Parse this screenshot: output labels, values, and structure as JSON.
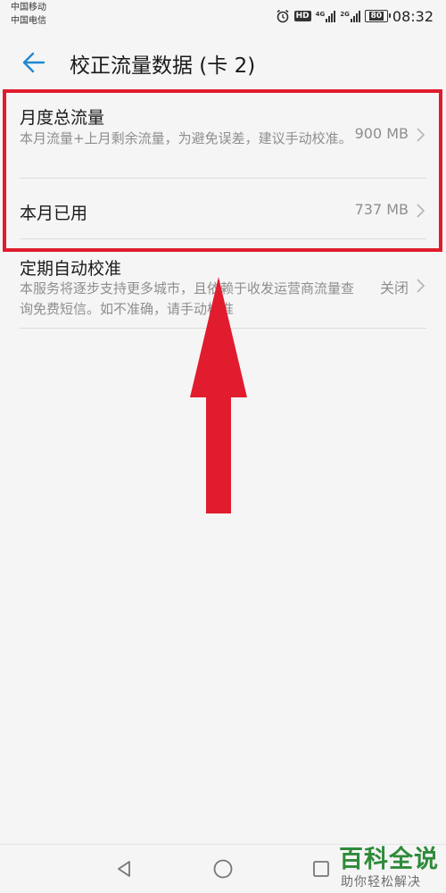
{
  "status_bar": {
    "carrier_1": "中国移动",
    "carrier_2": "中国电信",
    "alarm_icon": "alarm-clock-icon",
    "hd_label": "HD",
    "network_1": "4G",
    "network_2": "2G",
    "battery": "80",
    "time": "08:32"
  },
  "header": {
    "back_icon": "arrow-left-icon",
    "title": "校正流量数据 (卡 2)"
  },
  "items": [
    {
      "title": "月度总流量",
      "description": "本月流量+上月剩余流量，为避免误差，建议手动校准。",
      "value": "900 MB"
    },
    {
      "title": "本月已用",
      "description": "",
      "value": "737 MB"
    },
    {
      "title": "定期自动校准",
      "description": "本服务将逐步支持更多城市，且依赖于收发运营商流量查询免费短信。如不准确，请手动校准",
      "value": "关闭"
    }
  ],
  "nav": {
    "back_icon": "triangle-back-icon",
    "home_icon": "circle-home-icon",
    "recent_icon": "square-recent-icon"
  },
  "watermark": {
    "title": "百科全说",
    "subtitle": "助你轻松解决"
  },
  "colors": {
    "accent": "#1e88d2",
    "highlight": "#e11c2e",
    "watermark": "#2e8b3a"
  }
}
